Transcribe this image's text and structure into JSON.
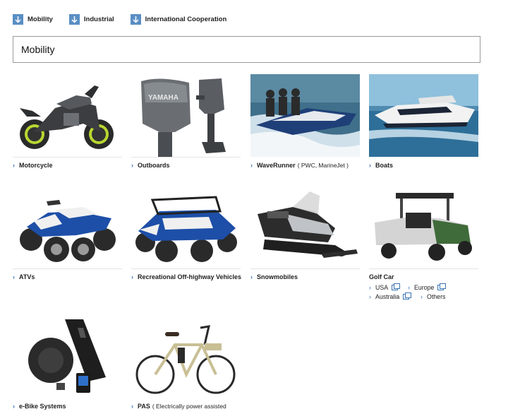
{
  "anchor_nav": [
    {
      "label": "Mobility",
      "icon": "down-arrow-icon"
    },
    {
      "label": "Industrial",
      "icon": "down-arrow-icon"
    },
    {
      "label": "International Cooperation",
      "icon": "down-arrow-icon"
    }
  ],
  "section": {
    "title": "Mobility"
  },
  "products": [
    {
      "label": "Motorcycle",
      "sub": ""
    },
    {
      "label": "Outboards",
      "sub": ""
    },
    {
      "label": "WaveRunner",
      "sub": "( PWC, MarineJet )"
    },
    {
      "label": "Boats",
      "sub": ""
    },
    {
      "label": "ATVs",
      "sub": ""
    },
    {
      "label": "Recreational Off-highway Vehicles",
      "sub": ""
    },
    {
      "label": "Snowmobiles",
      "sub": ""
    },
    {
      "label": "Golf Car",
      "sub": ""
    },
    {
      "label": "e-Bike Systems",
      "sub": ""
    },
    {
      "label": "PAS",
      "sub": "( Electrically power assisted"
    }
  ],
  "golf_car_links": [
    {
      "label": "USA"
    },
    {
      "label": "Europe"
    },
    {
      "label": "Australia"
    },
    {
      "label": "Others"
    }
  ],
  "brand_text": "YAMAHA",
  "colors": {
    "accent": "#3a73b3",
    "arrow_box": "#5a8fc4"
  }
}
